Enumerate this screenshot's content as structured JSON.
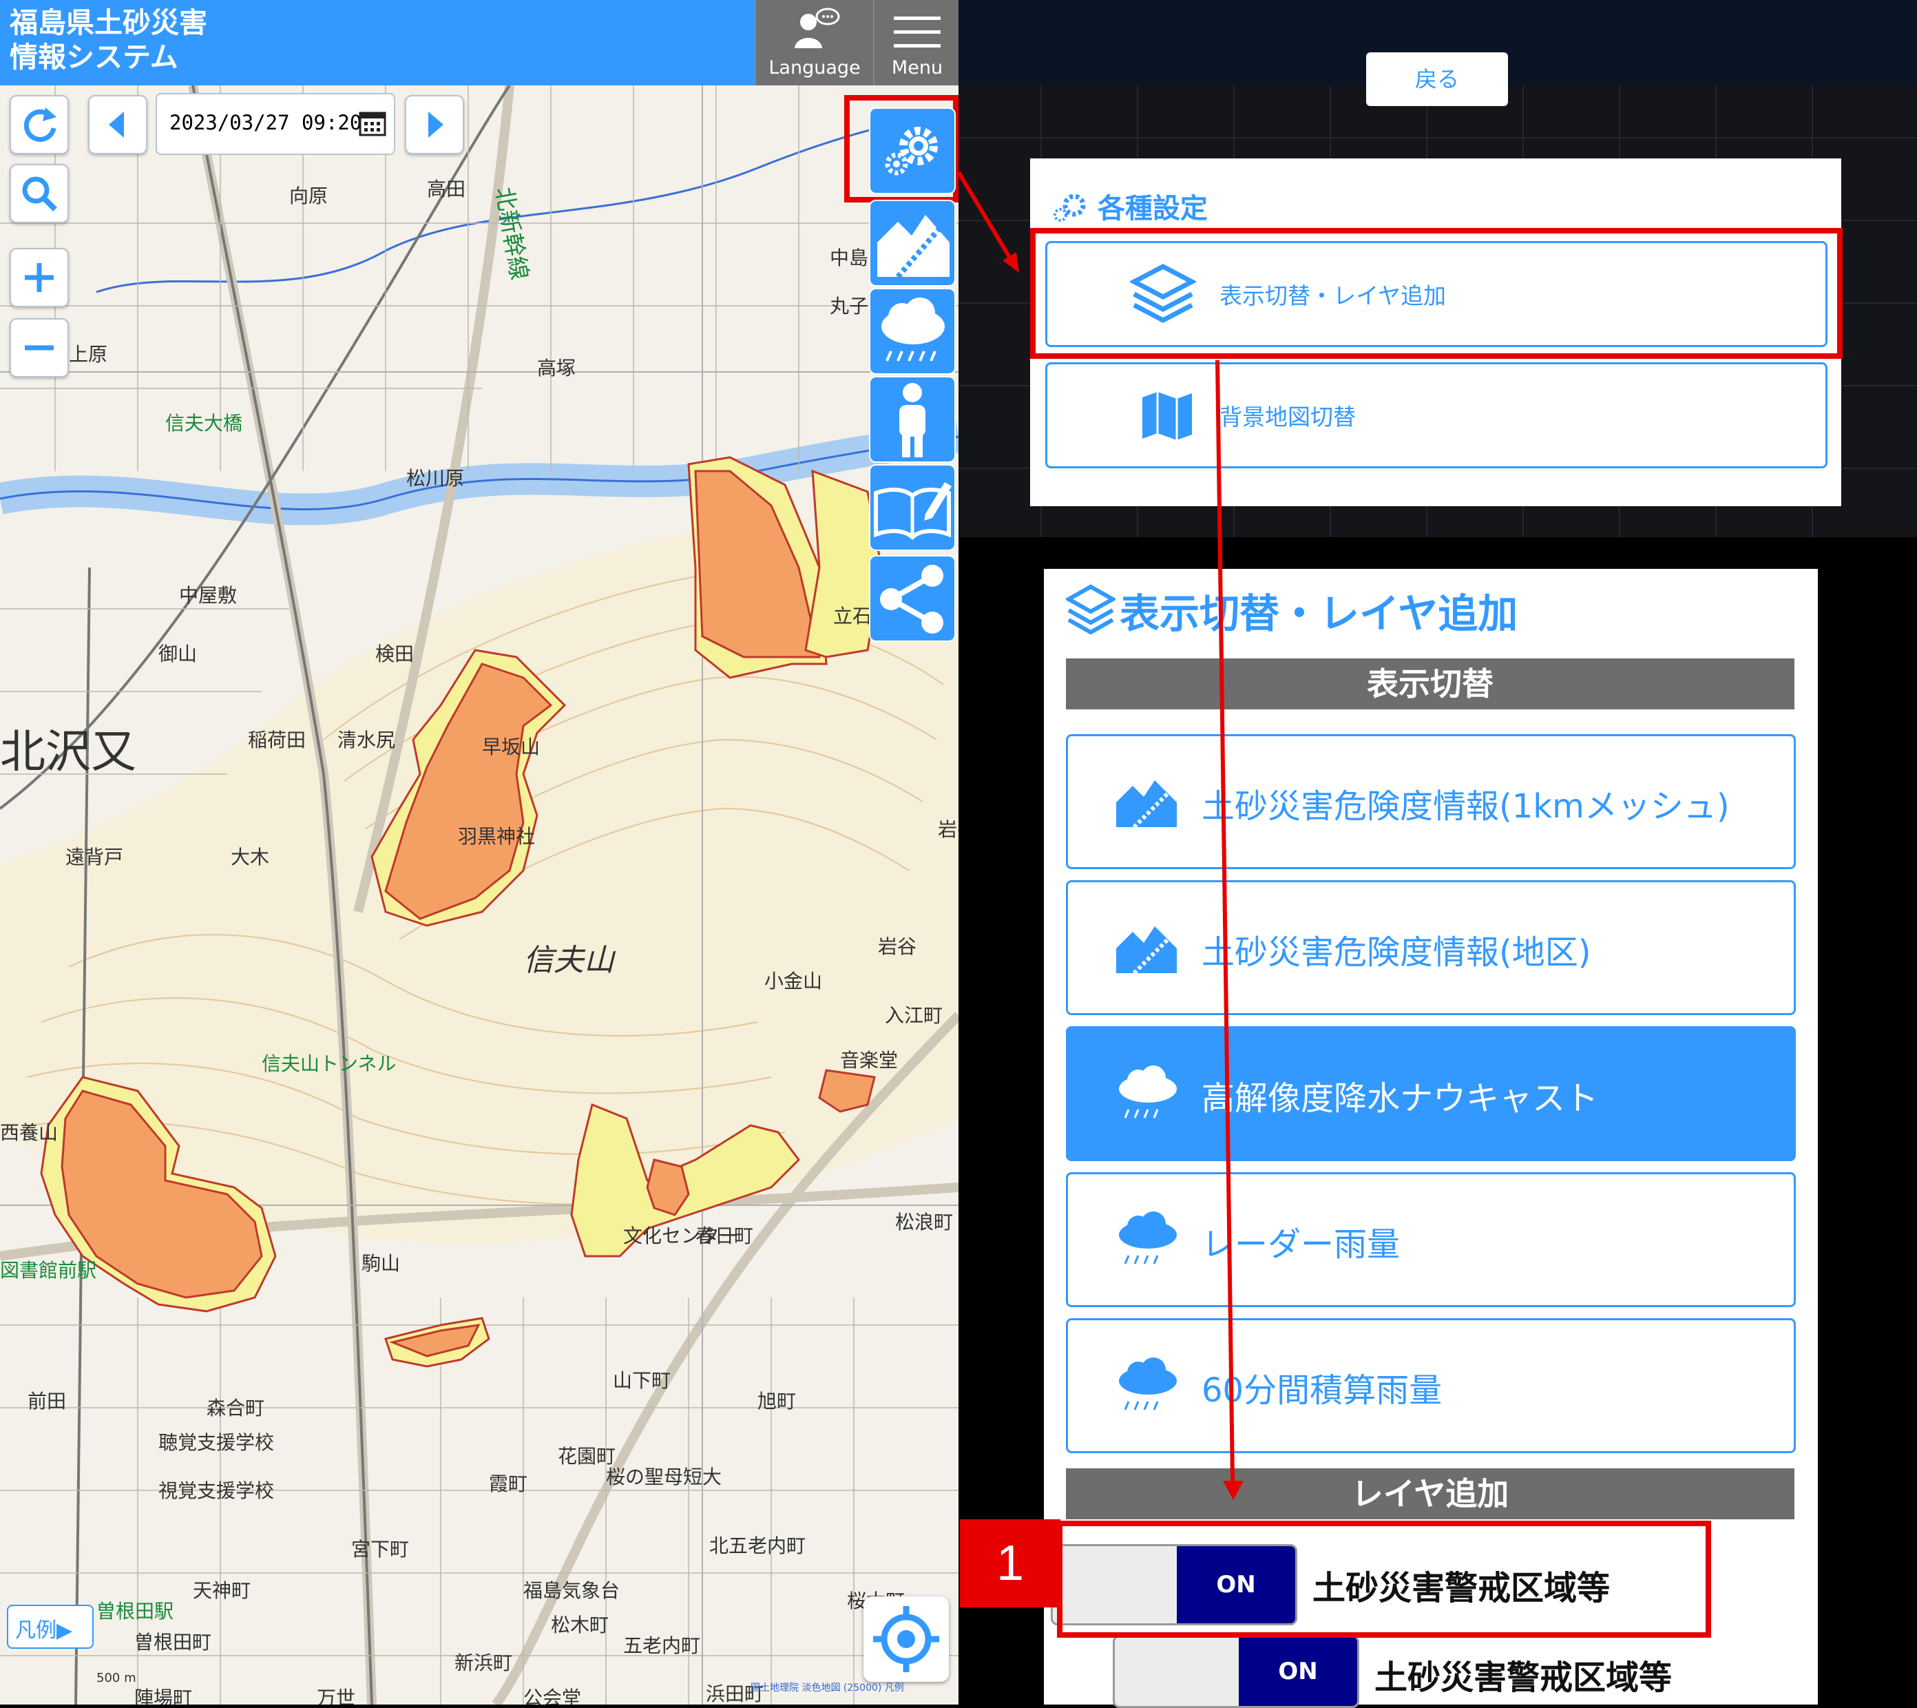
{
  "app": {
    "title": "福島県土砂災害\n情報システム",
    "language_label": "Language",
    "menu_label": "Menu"
  },
  "map_controls": {
    "date_value": "2023/03/27 09:20",
    "legend_label": "凡例▶",
    "scale_label": "500 m",
    "attribution": "国土地理院 淡色地図 (25000) 凡例"
  },
  "map_labels": [
    "北新幹線",
    "向原",
    "高田",
    "上原",
    "高塚",
    "信夫大橋",
    "松川原",
    "中屋敷",
    "御山",
    "検田",
    "北沢又",
    "稲荷田",
    "清水尻",
    "早坂山",
    "羽黒神社",
    "遠背戸",
    "大木",
    "信夫山",
    "岩谷",
    "小金山",
    "入江町",
    "音楽堂",
    "信夫山トンネル",
    "西養山",
    "図書館前駅",
    "駒山",
    "春日町",
    "文化センター",
    "山下町",
    "森合町",
    "聴覚支援学校",
    "視覚支援学校",
    "前田",
    "旭町",
    "霞町",
    "花園町",
    "桜の聖母短大",
    "北五老内町",
    "天神町",
    "曽根田駅",
    "宮下町",
    "福島気象台",
    "松木町",
    "五老内町",
    "桜木町",
    "新浜町",
    "浜田町",
    "万世",
    "陣場町",
    "曽根田町",
    "岩谷観音",
    "丸子",
    "中島",
    "立石",
    "公会堂",
    "松浪町"
  ],
  "settings": {
    "back_label": "戻る",
    "title": "各種設定",
    "items": [
      {
        "label": "表示切替・レイヤ追加"
      },
      {
        "label": "背景地図切替"
      }
    ]
  },
  "layer_panel": {
    "title": "表示切替・レイヤ追加",
    "display_section": "表示切替",
    "options": [
      {
        "label": "土砂災害危険度情報(1kmメッシュ)",
        "icon": "landslide-icon",
        "active": false
      },
      {
        "label": "土砂災害危険度情報(地区)",
        "icon": "landslide-icon",
        "active": false
      },
      {
        "label": "高解像度降水ナウキャスト",
        "icon": "rain-cloud-icon",
        "active": true
      },
      {
        "label": "レーダー雨量",
        "icon": "rain-cloud-icon",
        "active": false
      },
      {
        "label": "60分間積算雨量",
        "icon": "rain-cloud-icon",
        "active": false
      }
    ],
    "layer_section": "レイヤ追加",
    "toggles": [
      {
        "state": "ON",
        "label": "土砂災害警戒区域等"
      },
      {
        "state": "ON",
        "label": "土砂災害警戒区域等"
      }
    ]
  },
  "annotation": {
    "step_number": "1"
  },
  "colors": {
    "primary": "#3399ff",
    "highlight": "#e60000",
    "toggle_on": "#00008b",
    "hazard_orange": "#f4a064",
    "hazard_yellow": "#f6f29a"
  }
}
